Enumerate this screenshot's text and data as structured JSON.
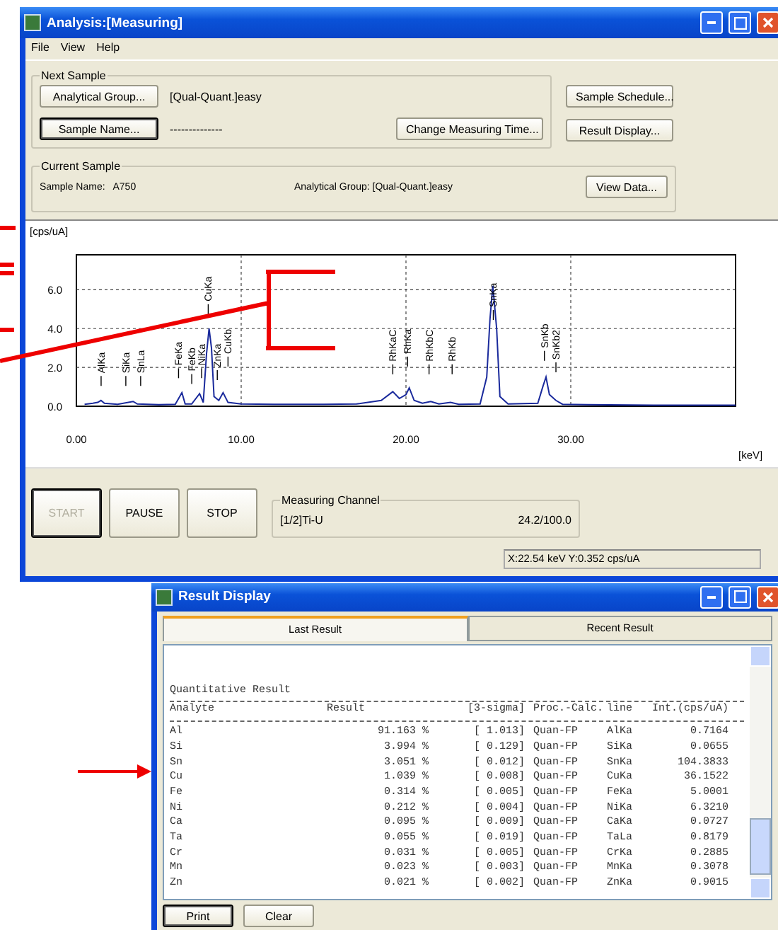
{
  "main_window": {
    "title": "Analysis:[Measuring]",
    "menu": [
      "File",
      "View",
      "Help"
    ],
    "next_sample": {
      "title": "Next Sample",
      "rows": [
        {
          "label": "Analytical Group...",
          "value": "[Qual-Quant.]easy",
          "default": false
        },
        {
          "label": "Sample Name...",
          "value": "--------------",
          "default": true
        }
      ],
      "change_time_button": "Change Measuring Time..."
    },
    "side_buttons": [
      "Sample Schedule...",
      "Result Display..."
    ],
    "current_sample": {
      "title": "Current Sample",
      "sample_name": "Sample Name:   A750",
      "analytical_group": "Analytical Group: [Qual-Quant.]easy",
      "view_data_button": "View Data..."
    },
    "spectrum": {
      "chart_data": {
        "type": "line",
        "grid": true,
        "xlabel": "[keV]",
        "ylabel": "[cps/uA]",
        "xlim": [
          0,
          40
        ],
        "ylim": [
          0,
          7.8
        ],
        "xticks": [
          {
            "value": 0,
            "label": "0.00"
          },
          {
            "value": 10,
            "label": "10.00"
          },
          {
            "value": 20,
            "label": "20.00"
          },
          {
            "value": 30,
            "label": "30.00"
          }
        ],
        "yticks": [
          {
            "value": 0,
            "label": "0.0"
          },
          {
            "value": 2,
            "label": "2.0"
          },
          {
            "value": 4,
            "label": "4.0"
          },
          {
            "value": 6,
            "label": "6.0"
          }
        ],
        "x": [
          0.5,
          1.0,
          1.3,
          1.49,
          1.7,
          2.5,
          3.44,
          3.7,
          5,
          6.0,
          6.4,
          6.6,
          7.0,
          7.48,
          7.7,
          7.9,
          8.05,
          8.2,
          8.35,
          8.64,
          8.9,
          9.2,
          10,
          12,
          15,
          17,
          18.5,
          19.2,
          19.6,
          20.0,
          20.2,
          20.5,
          21.0,
          21.5,
          22.0,
          22.7,
          23.2,
          24.5,
          24.9,
          25.1,
          25.27,
          25.5,
          25.7,
          26.2,
          28.0,
          28.3,
          28.5,
          28.7,
          29.1,
          29.5,
          31,
          35,
          40
        ],
        "values": [
          0.1,
          0.15,
          0.2,
          0.3,
          0.15,
          0.1,
          0.25,
          0.12,
          0.08,
          0.1,
          0.7,
          0.12,
          0.12,
          0.65,
          0.2,
          2.7,
          4.0,
          3.0,
          0.5,
          0.3,
          0.7,
          0.2,
          0.12,
          0.1,
          0.1,
          0.12,
          0.3,
          0.75,
          0.4,
          0.6,
          0.95,
          0.3,
          0.15,
          0.25,
          0.12,
          0.2,
          0.1,
          0.12,
          1.5,
          4.5,
          6.2,
          4.0,
          0.5,
          0.12,
          0.15,
          1.0,
          1.5,
          0.6,
          0.3,
          0.1,
          0.08,
          0.06,
          0.05
        ],
        "annotations": [
          "AlKa",
          "SiKa",
          "SnLa",
          "FeKa",
          "FeKb",
          "NiKa",
          "CuKa",
          "ZnKa",
          "CuKb",
          "RhKaC",
          "RhKa",
          "RhKbC",
          "RhKb",
          "SnKa",
          "SnKb",
          "SnKb2"
        ]
      }
    },
    "controls": [
      {
        "label": "START",
        "disabled": true
      },
      {
        "label": "PAUSE",
        "disabled": false
      },
      {
        "label": "STOP",
        "disabled": false
      }
    ],
    "measuring_channel": {
      "title": "Measuring Channel",
      "channel": "[1/2]Ti-U",
      "progress": "24.2/100.0"
    },
    "status_bar": "X:22.54 keV  Y:0.352 cps/uA"
  },
  "result_window": {
    "title": "Result Display",
    "tabs": [
      {
        "label": "Last Result",
        "selected": true
      },
      {
        "label": "Recent Result",
        "selected": false
      }
    ],
    "heading": "Quantitative Result",
    "columns": [
      "Analyte",
      "Result",
      "[3-sigma]",
      "Proc.-Calc.",
      "line",
      "Int.(cps/uA)"
    ],
    "rows": [
      [
        "Al",
        "91.163 %",
        "[ 1.013]",
        "Quan-FP",
        "AlKa",
        "0.7164"
      ],
      [
        "Si",
        "3.994 %",
        "[ 0.129]",
        "Quan-FP",
        "SiKa",
        "0.0655"
      ],
      [
        "Sn",
        "3.051 %",
        "[ 0.012]",
        "Quan-FP",
        "SnKa",
        "104.3833"
      ],
      [
        "Cu",
        "1.039 %",
        "[ 0.008]",
        "Quan-FP",
        "CuKa",
        "36.1522"
      ],
      [
        "Fe",
        "0.314 %",
        "[ 0.005]",
        "Quan-FP",
        "FeKa",
        "5.0001"
      ],
      [
        "Ni",
        "0.212 %",
        "[ 0.004]",
        "Quan-FP",
        "NiKa",
        "6.3210"
      ],
      [
        "Ca",
        "0.095 %",
        "[ 0.009]",
        "Quan-FP",
        "CaKa",
        "0.0727"
      ],
      [
        "Ta",
        "0.055 %",
        "[ 0.019]",
        "Quan-FP",
        "TaLa",
        "0.8179"
      ],
      [
        "Cr",
        "0.031 %",
        "[ 0.005]",
        "Quan-FP",
        "CrKa",
        "0.2885"
      ],
      [
        "Mn",
        "0.023 %",
        "[ 0.003]",
        "Quan-FP",
        "MnKa",
        "0.3078"
      ],
      [
        "Zn",
        "0.021 %",
        "[ 0.002]",
        "Quan-FP",
        "ZnKa",
        "0.9015"
      ]
    ],
    "buttons": [
      {
        "label": "Print",
        "default": true
      },
      {
        "label": "Clear",
        "default": false
      }
    ]
  }
}
